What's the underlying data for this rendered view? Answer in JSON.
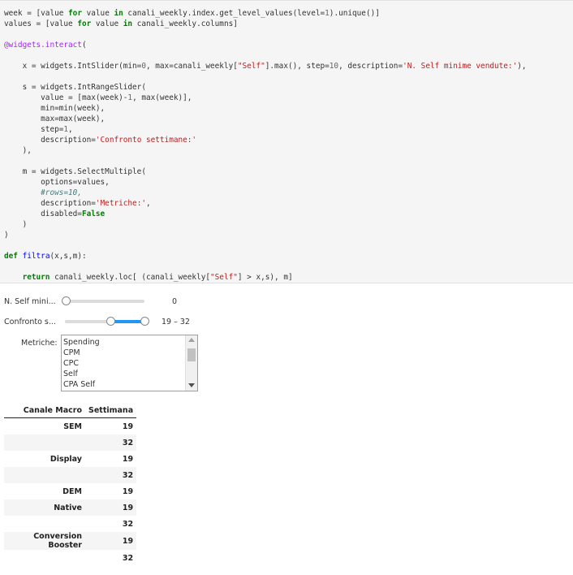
{
  "code_cell": {
    "lines": [
      "week = [value for value in canali_weekly.index.get_level_values(level=1).unique()]",
      "values = [value for value in canali_weekly.columns]",
      "",
      "@widgets.interact(",
      "",
      "    x = widgets.IntSlider(min=0, max=canali_weekly[\"Self\"].max(), step=10, description='N. Self minime vendute:'),",
      "",
      "    s = widgets.IntRangeSlider(",
      "        value = [max(week)-1, max(week)],",
      "        min=min(week),",
      "        max=max(week),",
      "        step=1,",
      "        description='Confronto settimane:'",
      "    ),",
      "",
      "    m = widgets.SelectMultiple(",
      "        options=values,",
      "        #rows=10,",
      "        description='Metriche:',",
      "        disabled=False",
      "    )",
      ")",
      "",
      "def filtra(x,s,m):",
      "",
      "    return canali_weekly.loc[ (canali_weekly[\"Self\"] > x,s), m]"
    ]
  },
  "widgets": {
    "self_slider": {
      "label": "N. Self mini...",
      "value": 0,
      "readout": "0",
      "fill_fraction": 0.0
    },
    "range_slider": {
      "label": "Confronto s...",
      "low": 19,
      "high": 32,
      "readout": "19 – 32"
    },
    "select_multiple": {
      "label": "Metriche:",
      "options": [
        "Spending",
        "CPM",
        "CPC",
        "Self",
        "CPA Self"
      ]
    }
  },
  "table": {
    "headers": [
      "Canale Macro",
      "Settimana"
    ],
    "rows": [
      {
        "macro": "SEM",
        "week": "19"
      },
      {
        "macro": "",
        "week": "32"
      },
      {
        "macro": "Display",
        "week": "19"
      },
      {
        "macro": "",
        "week": "32"
      },
      {
        "macro": "DEM",
        "week": "19"
      },
      {
        "macro": "Native",
        "week": "19"
      },
      {
        "macro": "",
        "week": "32"
      },
      {
        "macro": "Conversion Booster",
        "week": "19"
      },
      {
        "macro": "",
        "week": "32"
      }
    ]
  },
  "colors": {
    "accent": "#2196f3",
    "code_bg": "#f5f5f5"
  }
}
